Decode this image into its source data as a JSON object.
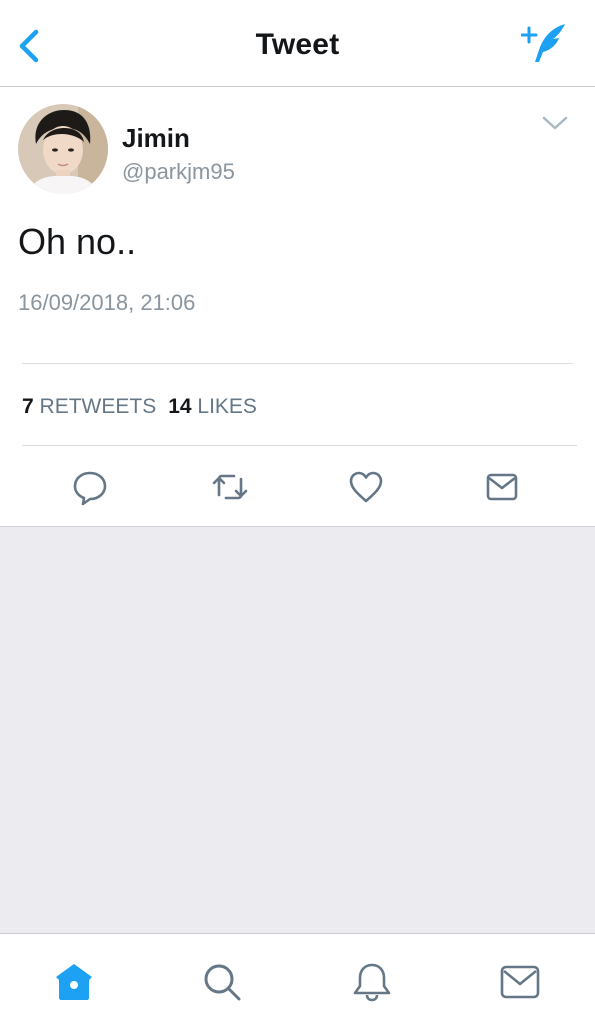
{
  "header": {
    "title": "Tweet",
    "back_icon": "chevron-left-icon",
    "compose_icon": "compose-tweet-icon",
    "accent_color": "#1da1f2"
  },
  "tweet": {
    "display_name": "Jimin",
    "handle": "@parkjm95",
    "text": "Oh no..",
    "timestamp": "16/09/2018, 21:06",
    "retweets_count": "7",
    "retweets_label": "RETWEETS",
    "likes_count": "14",
    "likes_label": "LIKES",
    "menu_icon": "chevron-down-icon",
    "actions": [
      "reply-icon",
      "retweet-icon",
      "like-icon",
      "direct-message-icon"
    ]
  },
  "tabbar": {
    "tabs": [
      "home-icon",
      "search-icon",
      "notifications-icon",
      "messages-icon"
    ],
    "active_tab": "home-icon"
  }
}
